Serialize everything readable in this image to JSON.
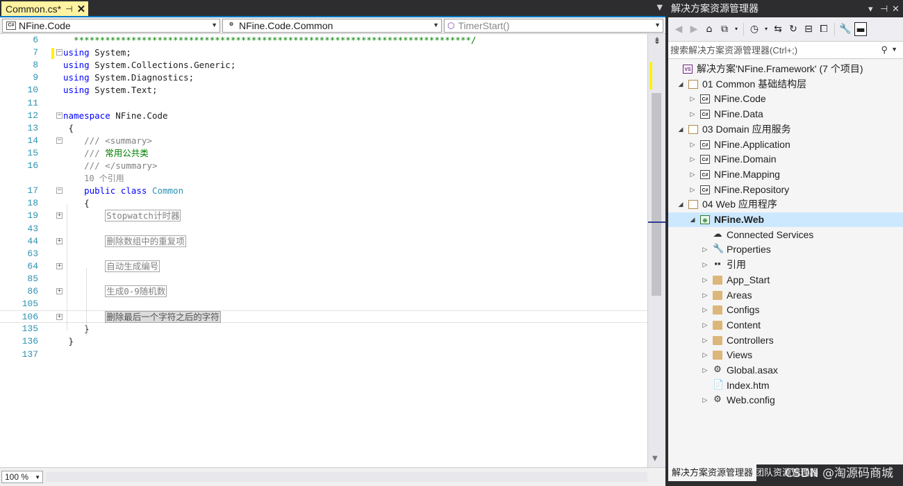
{
  "editor": {
    "tab": {
      "title": "Common.cs*",
      "pin_glyph": "⊣",
      "close_glyph": "✕"
    },
    "nav": {
      "project_combo": "NFine.Code",
      "type_combo": "NFine.Code.Common",
      "member_combo": "TimerStart()"
    },
    "zoom": "100 %",
    "lines": [
      {
        "n": "6",
        "text": "  ****************************************************************************/"
      },
      {
        "n": "7",
        "pre": "",
        "kw": "using",
        "rest": " System;"
      },
      {
        "n": "8",
        "kw": "using",
        "rest": " System.Collections.Generic;"
      },
      {
        "n": "9",
        "kw": "using",
        "rest": " System.Diagnostics;"
      },
      {
        "n": "10",
        "kw": "using",
        "rest": " System.Text;"
      },
      {
        "n": "11"
      },
      {
        "n": "12",
        "kw": "namespace",
        "rest": " NFine.Code"
      },
      {
        "n": "13",
        "rest": " {"
      },
      {
        "n": "14",
        "slashes": "    ///",
        "tag": " <summary>"
      },
      {
        "n": "15",
        "slashes": "    ///",
        "comment": " 常用公共类"
      },
      {
        "n": "16",
        "slashes": "    ///",
        "tag": " </summary>"
      },
      {
        "ref_hint": "10 个引用"
      },
      {
        "n": "17",
        "kw": "public class",
        "type": "Common"
      },
      {
        "n": "18",
        "rest": "    {"
      },
      {
        "n": "19",
        "region": "Stopwatch计时器"
      },
      {
        "n": "43"
      },
      {
        "n": "44",
        "region": "删除数组中的重复项"
      },
      {
        "n": "63"
      },
      {
        "n": "64",
        "region": "自动生成编号"
      },
      {
        "n": "85"
      },
      {
        "n": "86",
        "region": "生成0-9随机数"
      },
      {
        "n": "105"
      },
      {
        "n": "106",
        "region": "删除最后一个字符之后的字符"
      },
      {
        "n": "135",
        "rest": "    }"
      },
      {
        "n": "136",
        "rest": " }"
      },
      {
        "n": "137"
      }
    ]
  },
  "solution_explorer": {
    "title": "解决方案资源管理器",
    "header_buttons": [
      "▾",
      "⊣",
      "✕"
    ],
    "search_placeholder": "搜索解决方案资源管理器(Ctrl+;)",
    "tree": [
      {
        "label": "解决方案'NFine.Framework' (7 个项目)",
        "icon": "sln",
        "depth": 0,
        "tw": ""
      },
      {
        "label": "01 Common 基础结构层",
        "icon": "folder-open",
        "depth": 1,
        "tw": "◢"
      },
      {
        "label": "NFine.Code",
        "icon": "cs",
        "depth": 2,
        "tw": "▷"
      },
      {
        "label": "NFine.Data",
        "icon": "cs",
        "depth": 2,
        "tw": "▷"
      },
      {
        "label": "03 Domain 应用服务",
        "icon": "folder-open",
        "depth": 1,
        "tw": "◢"
      },
      {
        "label": "NFine.Application",
        "icon": "cs",
        "depth": 2,
        "tw": "▷"
      },
      {
        "label": "NFine.Domain",
        "icon": "cs",
        "depth": 2,
        "tw": "▷"
      },
      {
        "label": "NFine.Mapping",
        "icon": "cs",
        "depth": 2,
        "tw": "▷"
      },
      {
        "label": "NFine.Repository",
        "icon": "cs",
        "depth": 2,
        "tw": "▷"
      },
      {
        "label": "04 Web 应用程序",
        "icon": "folder-open",
        "depth": 1,
        "tw": "◢"
      },
      {
        "label": "NFine.Web",
        "icon": "web",
        "depth": 2,
        "tw": "◢",
        "selected": true
      },
      {
        "label": "Connected Services",
        "icon": "glyph-cloud",
        "depth": 3,
        "tw": ""
      },
      {
        "label": "Properties",
        "icon": "glyph-wrench",
        "depth": 3,
        "tw": "▷"
      },
      {
        "label": "引用",
        "icon": "glyph-ref",
        "depth": 3,
        "tw": "▷"
      },
      {
        "label": "App_Start",
        "icon": "folder",
        "depth": 3,
        "tw": "▷"
      },
      {
        "label": "Areas",
        "icon": "folder",
        "depth": 3,
        "tw": "▷"
      },
      {
        "label": "Configs",
        "icon": "folder",
        "depth": 3,
        "tw": "▷"
      },
      {
        "label": "Content",
        "icon": "folder",
        "depth": 3,
        "tw": "▷"
      },
      {
        "label": "Controllers",
        "icon": "folder",
        "depth": 3,
        "tw": "▷"
      },
      {
        "label": "Views",
        "icon": "folder",
        "depth": 3,
        "tw": "▷"
      },
      {
        "label": "Global.asax",
        "icon": "glyph-asax",
        "depth": 3,
        "tw": "▷"
      },
      {
        "label": "Index.htm",
        "icon": "glyph-htm",
        "depth": 3,
        "tw": ""
      },
      {
        "label": "Web.config",
        "icon": "glyph-config",
        "depth": 3,
        "tw": "▷"
      }
    ],
    "bottom_tabs": {
      "active": "解决方案资源管理器",
      "inactive": "团队资源管理器"
    },
    "watermark": "CSDN @淘源码商城"
  },
  "icons": {
    "cloud": "☁",
    "wrench": "🔧",
    "ref": "▪▪",
    "asax": "⚙",
    "htm": "📄",
    "config": "⚙"
  }
}
